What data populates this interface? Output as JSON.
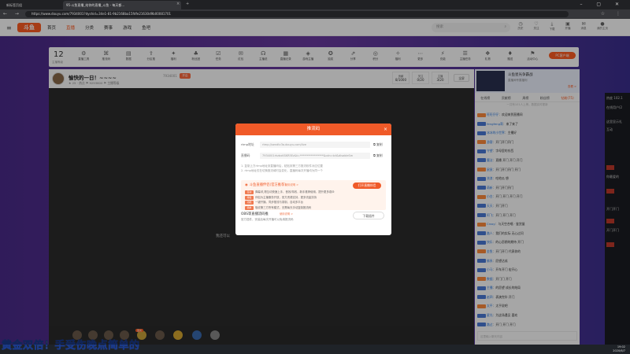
{
  "browser": {
    "tabs": [
      {
        "label": "新标签页组"
      },
      {
        "label": "95·斗鱼直播_给你的直播_斗鱼 - 每天都..."
      }
    ],
    "address": "https://www.douyu.com/7934001?dyshid=34e1-81-9b2168ba15fdfe21630d9b00081701"
  },
  "header": {
    "logo": "斗鱼",
    "nav": [
      "首页",
      "直播",
      "分类",
      "赛事",
      "游戏",
      "鱼吧"
    ],
    "search_placeholder": "搜索",
    "tools": [
      "历史",
      "关注",
      "下载",
      "开播",
      "消息",
      "我的主页"
    ]
  },
  "toolbar": {
    "level": "12",
    "level_sub": "主播等级",
    "items": [
      "直播工具",
      "推流码",
      "数据",
      "分区推",
      "福利",
      "粉丝团",
      "任务",
      "红包",
      "主播说",
      "直播记录",
      "游戏主播",
      "抽奖",
      "分享",
      "积分",
      "福利",
      "更多",
      "充能",
      "主播任务",
      "礼物",
      "赠送",
      "活动中心"
    ],
    "pc_button": "PC客户端"
  },
  "room": {
    "title": "愉快的一日！~~~~",
    "id": "7934001",
    "badge": "开启",
    "meta": "★ 25 · 热点    ⚑ 9293600    ⚑ 主播等级",
    "stats": [
      {
        "label": "8/1000",
        "value": "贡献"
      },
      {
        "label": "0/20",
        "value": "关注"
      },
      {
        "label": "3/20",
        "value": "主播"
      }
    ],
    "fullscreen": "全屏"
  },
  "video": {
    "message": "我还可以"
  },
  "gifts": {
    "badge": "首充"
  },
  "right_panel": {
    "promo_title": "斗鱼星光争霸战",
    "promo_sub": "直播间专属福利",
    "promo_btn": "查看 >",
    "rank_tabs": [
      "在线榜",
      "贡献榜",
      "周榜",
      "粉丝榜",
      "钻粉(75)"
    ],
    "rank_hint": "一共有101人上榜，数据实时更新",
    "chat": [
      {
        "lvl": "15",
        "name": "旺旺仔仔",
        "text": "欢迎来到直播间"
      },
      {
        "lvl": "12",
        "name": "fengfeng哥",
        "text": "来了来了"
      },
      {
        "lvl": "8",
        "name": "冰冰的小世界",
        "text": "主播好"
      },
      {
        "lvl": "15",
        "name": "游客",
        "text": "开门开门开门"
      },
      {
        "lvl": "12",
        "name": "守望",
        "text": "字母里的东西"
      },
      {
        "lvl": "15",
        "name": "魔法",
        "text": "直播 开门 开门 开门"
      },
      {
        "lvl": "10",
        "name": "鼠鼠",
        "text": "开门开门开门 开门"
      },
      {
        "lvl": "8",
        "name": "流浪",
        "text": "吃地瓜 想"
      },
      {
        "lvl": "15",
        "name": "萌新",
        "text": "开门开门开门"
      },
      {
        "lvl": "12",
        "name": "小白",
        "text": "开门 开门 开门 开门"
      },
      {
        "lvl": "15",
        "name": "天天",
        "text": "开门开门"
      },
      {
        "lvl": "9",
        "name": "阿飞",
        "text": "开门 开门 开门"
      },
      {
        "lvl": "15",
        "name": "Crazy",
        "text": "与天空合唱 · 鉴赏量"
      },
      {
        "lvl": "12",
        "name": "路人",
        "text": "我们的实际 无心过问"
      },
      {
        "lvl": "10",
        "name": "快乐",
        "text": "的心愿期的期待 开门"
      },
      {
        "lvl": "15",
        "name": "金鱼",
        "text": "开门开门 代表你的"
      },
      {
        "lvl": "8",
        "name": "佛系",
        "text": "愿望达成"
      },
      {
        "lvl": "12",
        "name": "小马",
        "text": "开车开门 宏开心"
      },
      {
        "lvl": "15",
        "name": "数据",
        "text": "开门门 开门"
      },
      {
        "lvl": "10",
        "name": "主播",
        "text": "的愿望 成长的结局"
      },
      {
        "lvl": "15",
        "name": "赵四",
        "text": "表演完毕 开门"
      },
      {
        "lvl": "12",
        "name": "太平",
        "text": "太乎说吧"
      },
      {
        "lvl": "15",
        "name": "星光",
        "text": "为这场遇见 喜欢"
      },
      {
        "lvl": "10",
        "name": "路过",
        "text": "开门 开门 开门"
      },
      {
        "lvl": "15",
        "name": "kevin",
        "text": "我们的实际 无心过问"
      },
      {
        "lvl": "12",
        "name": "月亮",
        "text": "开门 开门 开门"
      },
      {
        "lvl": "8",
        "name": "不为",
        "text": "不为 来了"
      }
    ],
    "chat_placeholder": "这里输入聊天内容"
  },
  "obs_strip": {
    "lines": [
      "热度 102.1",
      "在线用户(2",
      "这里显示礼",
      "互动",
      "你最爱的",
      "开门开门",
      "开门开门"
    ]
  },
  "modal": {
    "title": "推流码",
    "close": "×",
    "rtmp_label": "rtmp地址",
    "rtmp_value": "rtmp://sendtc3a.douyu.com/live",
    "key_label": "直播码",
    "key_value": "7934001rhzbxKSKR5Ez&t=*****************&cdn=tct&disableSm",
    "copy": "复制",
    "notes": [
      "1. 复制上方rtmp地址到直播码后，粘贴到第三方推流软件对应位置",
      "2. rtmp地址仅在切换推流域时会变化，直播码每次开播均为同一个"
    ],
    "promo_title": "斗鱼直播伴侣(官方推荐)",
    "promo_note": "使用说明 >",
    "promo_button": "打开直播伴侣",
    "promo_lines": [
      {
        "tag": "互动",
        "text": "弹幕/礼物互动快速上手，音效/特效，新手推荐使用，提升更多观众"
      },
      {
        "tag": "特权",
        "text": "伴侣为主播服务开放，官方资源支持，更多流量扶持"
      },
      {
        "tag": "功能",
        "text": "一键开播，同步推流与录制，自动多平台"
      },
      {
        "tag": "简单",
        "text": "吸收第三方所有模式，无需每天手动复制推流码"
      }
    ],
    "obs_title": "OBS等直播流码推",
    "obs_note": "使用说明 >",
    "obs_desc": "官方插件，安装后每次开播可以免填推流码",
    "obs_button": "下载插件"
  },
  "overlay": "黄金双倍！手受伤晚点简单的",
  "taskbar": {
    "time": "19:02",
    "date": "2020/6/7"
  }
}
